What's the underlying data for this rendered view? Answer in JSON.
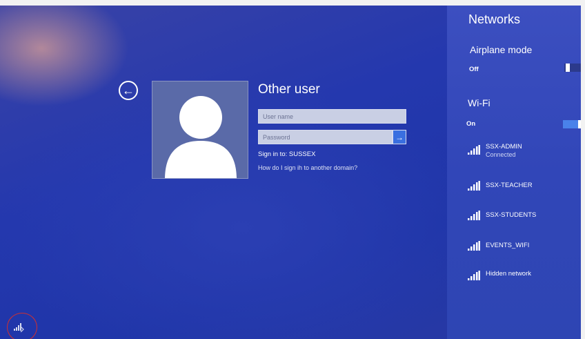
{
  "login": {
    "tile_title": "Other user",
    "username_placeholder": "User name",
    "password_placeholder": "Password",
    "submit_arrow": "→",
    "back_arrow": "←",
    "sign_in_to": "Sign in to: SUSSEX",
    "other_domain_link": "How do I sign ih to another domain?"
  },
  "networks": {
    "title": "Networks",
    "airplane_mode": {
      "label": "Airplane mode",
      "state": "Off"
    },
    "wifi": {
      "label": "Wi-Fi",
      "state": "On"
    },
    "items": [
      {
        "name": "SSX-ADMIN",
        "status": "Connected",
        "icon": "wifi-signal-icon"
      },
      {
        "name": "SSX-TEACHER",
        "status": "",
        "icon": "wifi-signal-icon"
      },
      {
        "name": "SSX-STUDENTS",
        "status": "",
        "icon": "wifi-signal-icon"
      },
      {
        "name": "EVENTS_WIFI",
        "status": "",
        "icon": "wifi-signal-icon"
      },
      {
        "name": "Hidden network",
        "status": "",
        "icon": "wifi-signal-icon"
      }
    ]
  },
  "colors": {
    "background": "#2438ae",
    "panel": "#3146b8",
    "accent": "#3a6fe0",
    "highlight_circle": "#d03030"
  }
}
